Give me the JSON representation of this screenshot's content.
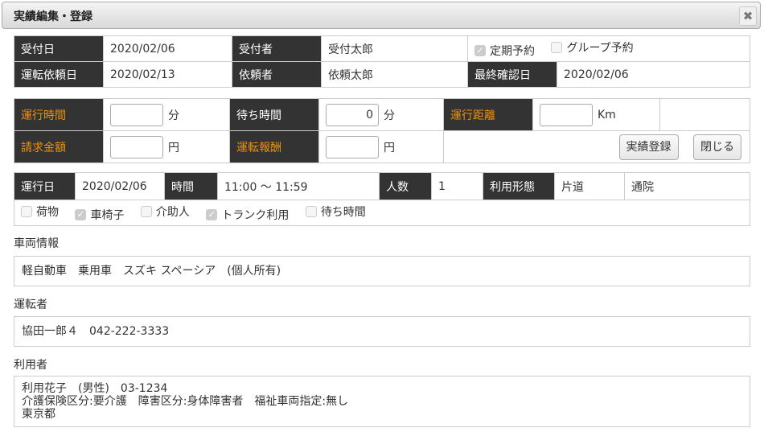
{
  "dialog": {
    "title": "実績編集・登録",
    "close_icon": "close-x-icon"
  },
  "header": {
    "reception_date_label": "受付日",
    "reception_date": "2020/02/06",
    "receptionist_label": "受付者",
    "receptionist": "受付太郎",
    "regular_reservation_label": "定期予約",
    "regular_reservation_checked": true,
    "group_reservation_label": "グループ予約",
    "group_reservation_checked": false,
    "request_date_label": "運転依頼日",
    "request_date": "2020/02/13",
    "requester_label": "依頼者",
    "requester": "依頼太郎",
    "last_confirm_label": "最終確認日",
    "last_confirm_date": "2020/02/06"
  },
  "results": {
    "run_time_label": "運行時間",
    "run_time_value": "",
    "run_time_unit": "分",
    "wait_time_label": "待ち時間",
    "wait_time_value": "0",
    "wait_time_unit": "分",
    "distance_label": "運行距離",
    "distance_value": "",
    "distance_unit": "Km",
    "billing_label": "請求金額",
    "billing_value": "",
    "billing_unit": "円",
    "driver_fee_label": "運転報酬",
    "driver_fee_value": "",
    "driver_fee_unit": "円",
    "register_button": "実績登録",
    "close_button": "閉じる"
  },
  "trip": {
    "run_date_label": "運行日",
    "run_date": "2020/02/06",
    "time_label": "時間",
    "time_range": "11:00 ～ 11:59",
    "people_label": "人数",
    "people": "1",
    "usage_type_label": "利用形態",
    "usage_type": "片道",
    "purpose": "通院",
    "options": [
      {
        "label": "荷物",
        "checked": false
      },
      {
        "label": "車椅子",
        "checked": true
      },
      {
        "label": "介助人",
        "checked": false
      },
      {
        "label": "トランク利用",
        "checked": true
      },
      {
        "label": "待ち時間",
        "checked": false
      }
    ]
  },
  "vehicle": {
    "label": "車両情報",
    "info": "軽自動車　乗用車　スズキ スペーシア　(個人所有)"
  },
  "driver": {
    "label": "運転者",
    "info": "協田一郎４　042-222-3333"
  },
  "user": {
    "label": "利用者",
    "line1": "利用花子　(男性)　03-1234",
    "line2": "介護保険区分:要介護　障害区分:身体障害者　福祉車両指定:無し",
    "line3": "東京都"
  }
}
